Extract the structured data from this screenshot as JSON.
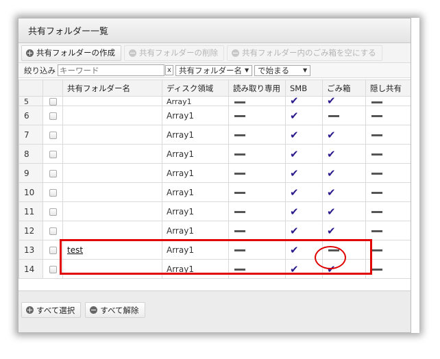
{
  "window": {
    "title": "共有フォルダー一覧"
  },
  "toolbar": {
    "create_label": "共有フォルダーの作成",
    "delete_label": "共有フォルダーの削除",
    "empty_trash_label": "共有フォルダー内のごみ箱を空にする"
  },
  "filter": {
    "label": "絞り込み",
    "keyword_placeholder": "キーワード",
    "clear_label": "x",
    "field_select": "共有フォルダー名",
    "match_select": "で始まる"
  },
  "table": {
    "columns": [
      "共有フォルダー名",
      "ディスク領域",
      "読み取り専用",
      "SMB",
      "ごみ箱",
      "隠し共有"
    ],
    "rows": [
      {
        "num": "5",
        "name": "",
        "disk": "Array1",
        "readonly": "dash",
        "smb": "check",
        "trash": "check",
        "hidden": "dash"
      },
      {
        "num": "6",
        "name": "",
        "disk": "Array1",
        "readonly": "dash",
        "smb": "check",
        "trash": "dash",
        "hidden": "dash"
      },
      {
        "num": "7",
        "name": "",
        "disk": "Array1",
        "readonly": "dash",
        "smb": "check",
        "trash": "check",
        "hidden": "dash"
      },
      {
        "num": "8",
        "name": "",
        "disk": "Array1",
        "readonly": "dash",
        "smb": "check",
        "trash": "check",
        "hidden": "dash"
      },
      {
        "num": "9",
        "name": "",
        "disk": "Array1",
        "readonly": "dash",
        "smb": "check",
        "trash": "check",
        "hidden": "dash"
      },
      {
        "num": "10",
        "name": "",
        "disk": "Array1",
        "readonly": "dash",
        "smb": "check",
        "trash": "check",
        "hidden": "dash"
      },
      {
        "num": "11",
        "name": "",
        "disk": "Array1",
        "readonly": "dash",
        "smb": "check",
        "trash": "check",
        "hidden": "dash"
      },
      {
        "num": "12",
        "name": "",
        "disk": "Array1",
        "readonly": "dash",
        "smb": "check",
        "trash": "check",
        "hidden": "dash"
      },
      {
        "num": "13",
        "name": "test",
        "disk": "Array1",
        "readonly": "dash",
        "smb": "check",
        "trash": "dash",
        "hidden": "dash"
      },
      {
        "num": "14",
        "name": "",
        "disk": "Array1",
        "readonly": "dash",
        "smb": "check",
        "trash": "check",
        "hidden": "dash"
      }
    ]
  },
  "footer": {
    "select_all_label": "すべて選択",
    "deselect_all_label": "すべて解除"
  },
  "colors": {
    "highlight": "#e00000",
    "check": "#2a1a8c"
  }
}
